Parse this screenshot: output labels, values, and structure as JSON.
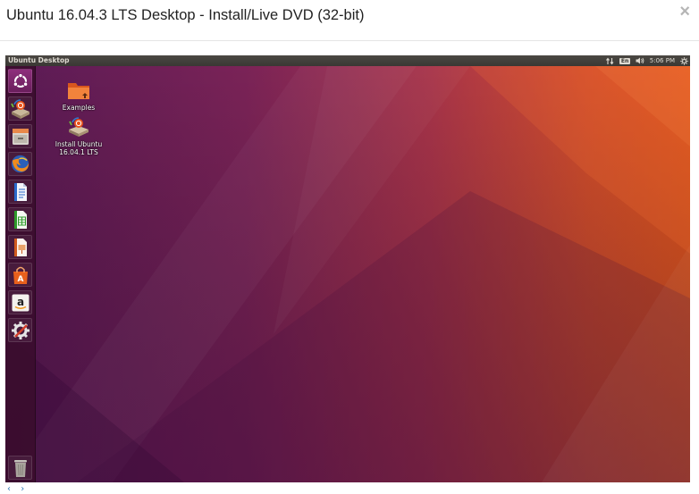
{
  "modal": {
    "title": "Ubuntu 16.04.3 LTS Desktop - Install/Live DVD (32-bit)",
    "close_glyph": "×"
  },
  "topbar": {
    "title": "Ubuntu Desktop",
    "keyboard_layout": "En",
    "clock": "5:06 PM",
    "icons": [
      "network-icon",
      "keyboard-layout-icon",
      "volume-icon",
      "system-gear-icon"
    ]
  },
  "launcher": {
    "items": [
      {
        "name": "dash-home",
        "icon": "ubuntu-logo-icon"
      },
      {
        "name": "install-ubuntu",
        "icon": "installer-icon"
      },
      {
        "name": "files",
        "icon": "file-cabinet-icon"
      },
      {
        "name": "firefox",
        "icon": "firefox-icon"
      },
      {
        "name": "libreoffice-writer",
        "icon": "writer-document-icon"
      },
      {
        "name": "libreoffice-calc",
        "icon": "calc-spreadsheet-icon"
      },
      {
        "name": "libreoffice-impress",
        "icon": "impress-presentation-icon"
      },
      {
        "name": "ubuntu-software",
        "icon": "software-bag-icon"
      },
      {
        "name": "amazon",
        "icon": "amazon-icon"
      },
      {
        "name": "system-settings",
        "icon": "settings-tools-icon"
      }
    ],
    "trash": {
      "name": "trash",
      "icon": "trash-icon"
    }
  },
  "desktop": {
    "icons": [
      {
        "label": "Examples",
        "icon": "folder-icon"
      },
      {
        "label_line1": "Install Ubuntu",
        "label_line2": "16.04.1 LTS",
        "icon": "installer-icon"
      }
    ]
  },
  "pager": {
    "prev": "‹",
    "next": "›"
  },
  "colors": {
    "wallpaper_purple": "#5e1f56",
    "wallpaper_orange": "#e35a1f",
    "launcher_bg": "#3a0d2c",
    "topbar_bg": "#3c3b37"
  }
}
